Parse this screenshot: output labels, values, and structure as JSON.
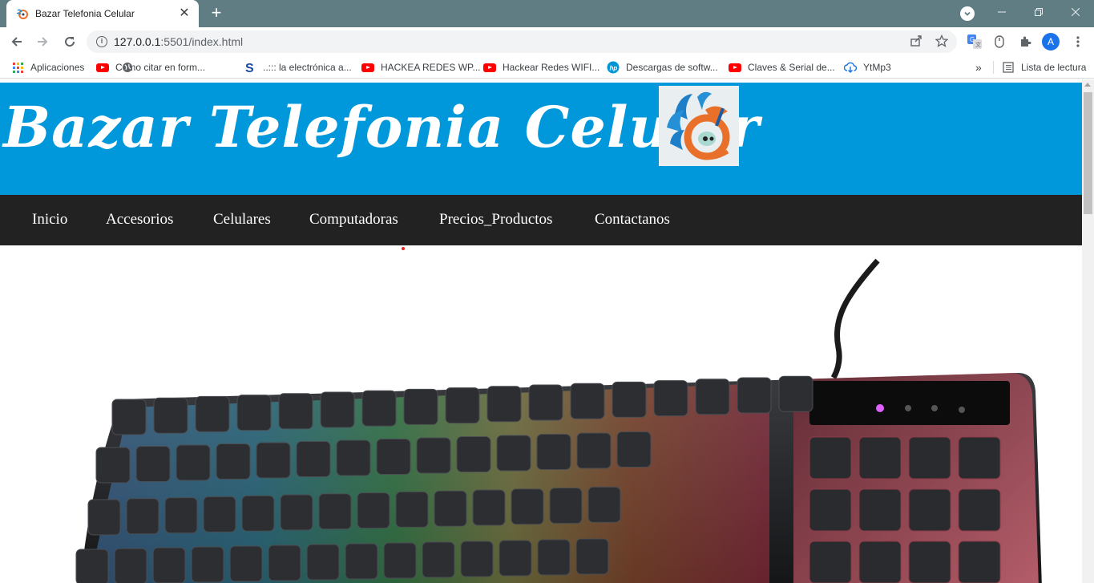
{
  "browser": {
    "tab_title": "Bazar Telefonia Celular",
    "new_tab_symbol": "+",
    "close_symbol": "✕",
    "url_host": "127.0.0.1",
    "url_path": ":5501/index.html",
    "avatar_letter": "A",
    "bookmarks": [
      {
        "label": "Aplicaciones",
        "icon": "apps-grid-icon"
      },
      {
        "label": "Como citar en form...",
        "icon": "youtube-icon"
      },
      {
        "label": "..::: la electrónica a...",
        "icon": "s-logo-icon"
      },
      {
        "label": "HACKEA REDES WP...",
        "icon": "youtube-icon"
      },
      {
        "label": "Hackear Redes WIFI...",
        "icon": "youtube-icon"
      },
      {
        "label": "Descargas de softw...",
        "icon": "hp-icon"
      },
      {
        "label": "Claves & Serial de...",
        "icon": "youtube-icon"
      },
      {
        "label": "YtMp3",
        "icon": "cloud-download-icon"
      }
    ],
    "overflow_label": "»",
    "reading_list_label": "Lista de lectura"
  },
  "site": {
    "title": "Bazar Telefonia Celular",
    "nav": [
      "Inicio",
      "Accesorios",
      "Celulares",
      "Computadoras",
      "Precios_Productos",
      "Contactanos"
    ],
    "colors": {
      "header": "#0098da",
      "navbar": "#222222",
      "nav_text": "#ffffff"
    }
  }
}
